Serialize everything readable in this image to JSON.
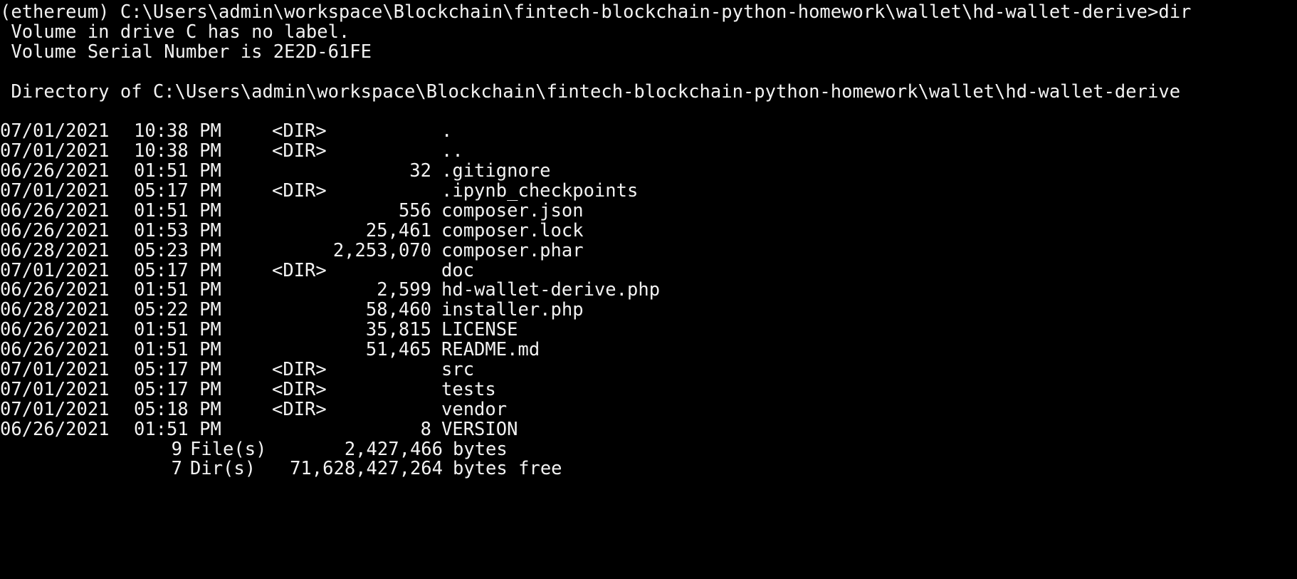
{
  "terminal": {
    "prompt_line": "(ethereum) C:\\Users\\admin\\workspace\\Blockchain\\fintech-blockchain-python-homework\\wallet\\hd-wallet-derive>dir",
    "volume_label_line": " Volume in drive C has no label.",
    "volume_serial_line": " Volume Serial Number is 2E2D-61FE",
    "directory_line": " Directory of C:\\Users\\admin\\workspace\\Blockchain\\fintech-blockchain-python-homework\\wallet\\hd-wallet-derive"
  },
  "entries": [
    {
      "date": "07/01/2021",
      "time": "10:38 PM",
      "dir": "<DIR>",
      "size": "",
      "name": "."
    },
    {
      "date": "07/01/2021",
      "time": "10:38 PM",
      "dir": "<DIR>",
      "size": "",
      "name": ".."
    },
    {
      "date": "06/26/2021",
      "time": "01:51 PM",
      "dir": "",
      "size": "32",
      "name": ".gitignore"
    },
    {
      "date": "07/01/2021",
      "time": "05:17 PM",
      "dir": "<DIR>",
      "size": "",
      "name": ".ipynb_checkpoints"
    },
    {
      "date": "06/26/2021",
      "time": "01:51 PM",
      "dir": "",
      "size": "556",
      "name": "composer.json"
    },
    {
      "date": "06/26/2021",
      "time": "01:53 PM",
      "dir": "",
      "size": "25,461",
      "name": "composer.lock"
    },
    {
      "date": "06/28/2021",
      "time": "05:23 PM",
      "dir": "",
      "size": "2,253,070",
      "name": "composer.phar"
    },
    {
      "date": "07/01/2021",
      "time": "05:17 PM",
      "dir": "<DIR>",
      "size": "",
      "name": "doc"
    },
    {
      "date": "06/26/2021",
      "time": "01:51 PM",
      "dir": "",
      "size": "2,599",
      "name": "hd-wallet-derive.php"
    },
    {
      "date": "06/28/2021",
      "time": "05:22 PM",
      "dir": "",
      "size": "58,460",
      "name": "installer.php"
    },
    {
      "date": "06/26/2021",
      "time": "01:51 PM",
      "dir": "",
      "size": "35,815",
      "name": "LICENSE"
    },
    {
      "date": "06/26/2021",
      "time": "01:51 PM",
      "dir": "",
      "size": "51,465",
      "name": "README.md"
    },
    {
      "date": "07/01/2021",
      "time": "05:17 PM",
      "dir": "<DIR>",
      "size": "",
      "name": "src"
    },
    {
      "date": "07/01/2021",
      "time": "05:17 PM",
      "dir": "<DIR>",
      "size": "",
      "name": "tests"
    },
    {
      "date": "07/01/2021",
      "time": "05:18 PM",
      "dir": "<DIR>",
      "size": "",
      "name": "vendor"
    },
    {
      "date": "06/26/2021",
      "time": "01:51 PM",
      "dir": "",
      "size": "8",
      "name": "VERSION"
    }
  ],
  "summary": {
    "files_count": "9",
    "files_kind": "File(s)",
    "files_value": "2,427,466",
    "files_unit": "bytes",
    "dirs_count": "7",
    "dirs_kind": "Dir(s)",
    "dirs_value": "71,628,427,264",
    "dirs_unit": "bytes free"
  },
  "colors": {
    "background": "#000000",
    "text": "#f2f2f2"
  }
}
